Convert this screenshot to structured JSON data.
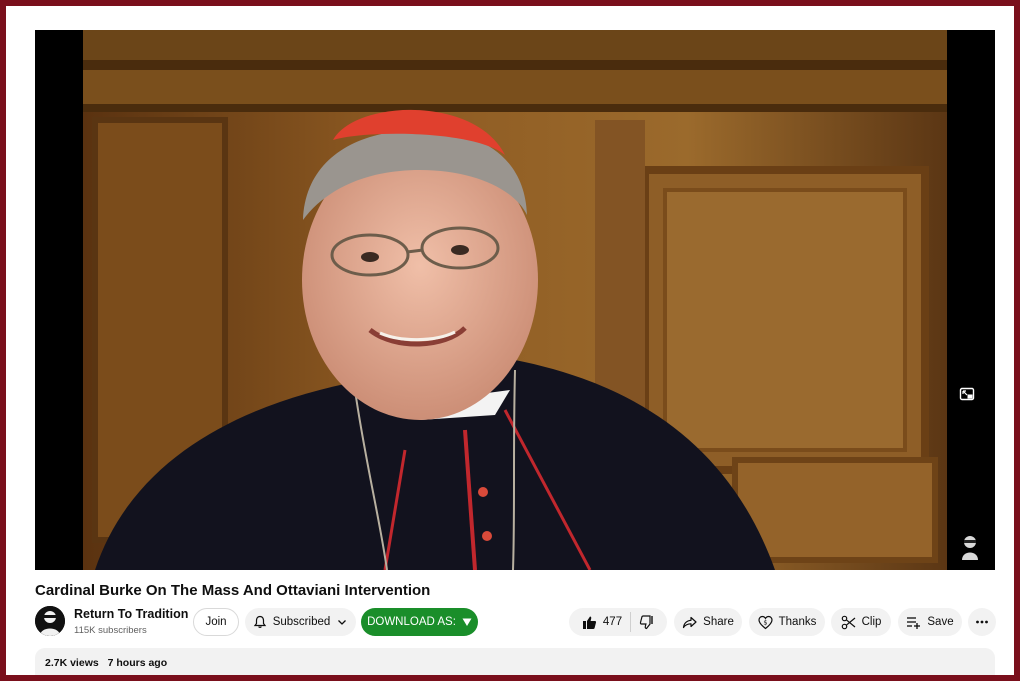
{
  "video": {
    "title": "Cardinal Burke On The Mass And Ottaviani Intervention"
  },
  "channel": {
    "name": "Return To Tradition",
    "subscribers": "115K subscribers"
  },
  "actions": {
    "join_label": "Join",
    "subscribed_label": "Subscribed",
    "download_label": "DOWNLOAD AS:",
    "like_count": "477",
    "share_label": "Share",
    "thanks_label": "Thanks",
    "clip_label": "Clip",
    "save_label": "Save"
  },
  "description": {
    "views": "2.7K views",
    "age": "7 hours ago"
  },
  "icons": {
    "miniplayer": "miniplayer-icon",
    "bell": "bell-icon",
    "chevron": "chevron-down-icon",
    "download_arrow": "triangle-down-icon",
    "like": "thumbs-up-icon",
    "dislike": "thumbs-down-icon",
    "share": "share-arrow-icon",
    "thanks": "heart-dollar-icon",
    "clip": "scissors-icon",
    "save": "playlist-add-icon",
    "more": "more-horizontal-icon"
  },
  "colors": {
    "page_border": "#7a0f1c",
    "download_button": "#1a8e2a",
    "pill_background": "#f2f2f2"
  }
}
